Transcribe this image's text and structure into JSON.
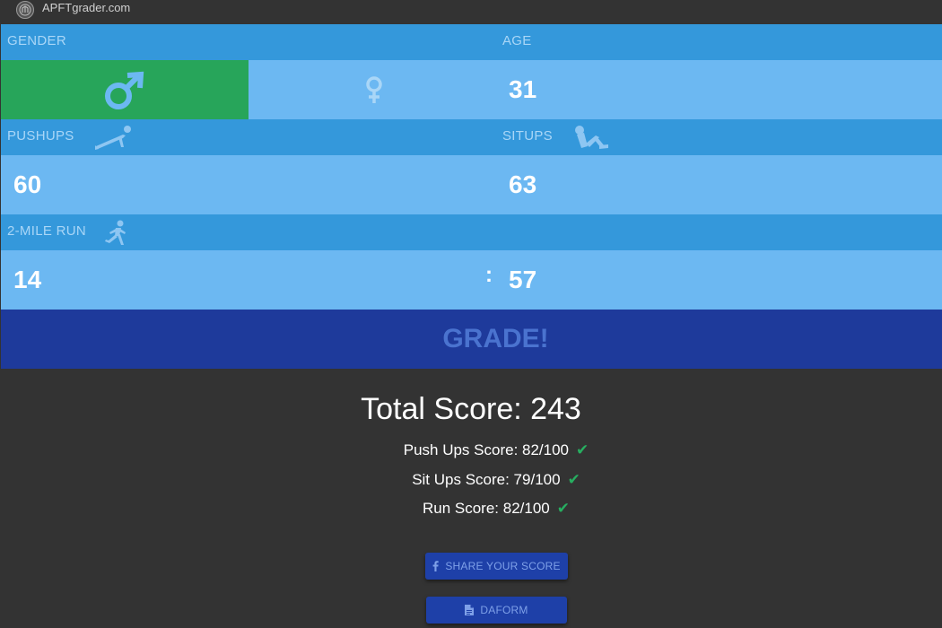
{
  "header": {
    "brand": "APFTgrader.com"
  },
  "form": {
    "gender_label": "GENDER",
    "age_label": "AGE",
    "age_value": "31",
    "pushups_label": "PUSHUPS",
    "situps_label": "SITUPS",
    "pushups_value": "60",
    "situps_value": "63",
    "run_label": "2-MILE RUN",
    "run_minutes": "14",
    "run_separator": ":",
    "run_seconds": "57",
    "selected_gender": "male",
    "grade_label": "GRADE!"
  },
  "results": {
    "total": "Total Score: 243",
    "pushups_score": "Push Ups Score: 82/100",
    "situps_score": "Sit Ups Score: 79/100",
    "run_score": "Run Score: 82/100",
    "share_label": "SHARE YOUR SCORE",
    "daform_label": "DAFORM"
  },
  "icons": {
    "male": "male-symbol-icon",
    "female": "female-symbol-icon",
    "pushups": "pushup-figure-icon",
    "situps": "situp-figure-icon",
    "run": "runner-figure-icon",
    "check": "checkmark-icon",
    "facebook": "facebook-icon",
    "document": "document-icon"
  },
  "colors": {
    "header_band": "#3498db",
    "value_band": "#6cb8f2",
    "selected": "#27a55a",
    "grade": "#1e3a9b",
    "check": "#27ae60"
  }
}
